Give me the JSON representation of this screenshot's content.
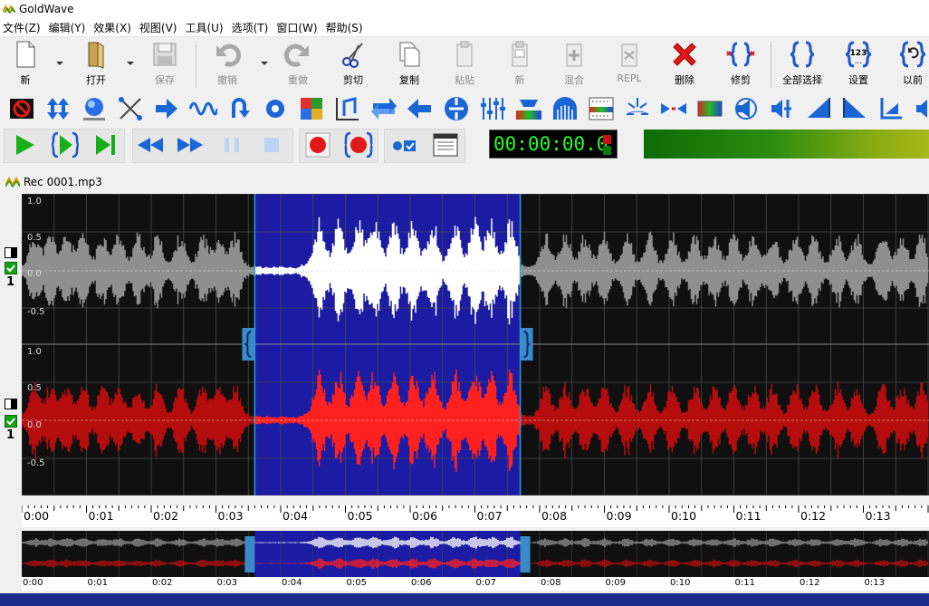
{
  "app": {
    "title": "GoldWave"
  },
  "menu": [
    "文件(Z)",
    "编辑(Y)",
    "效果(X)",
    "视图(V)",
    "工具(U)",
    "选项(T)",
    "窗口(W)",
    "帮助(S)"
  ],
  "toolbar": {
    "new": "新",
    "open": "打开",
    "save": "保存",
    "undo": "撤销",
    "redo": "重做",
    "cut": "剪切",
    "copy": "复制",
    "paste": "粘贴",
    "paste_new": "新",
    "mix": "混合",
    "replace": "REPL",
    "delete": "删除",
    "trim": "修剪",
    "select_all": "全部选择",
    "settings": "设置",
    "previous": "以前"
  },
  "counter": {
    "time": "00:00:00.0"
  },
  "document": {
    "title": "Rec 0001.mp3"
  },
  "channels": [
    {
      "number": "1",
      "y_labels": [
        "1.0",
        "0.5",
        "0.0",
        "-0.5"
      ]
    },
    {
      "number": "1",
      "y_labels": [
        "1.0",
        "0.5",
        "0.0",
        "-0.5"
      ]
    }
  ],
  "timeline": {
    "ticks": [
      "0:00",
      "0:01",
      "0:02",
      "0:03",
      "0:04",
      "0:05",
      "0:06",
      "0:07",
      "0:08",
      "0:09",
      "0:10",
      "0:11",
      "0:12",
      "0:13"
    ]
  },
  "overview_timeline": {
    "ticks": [
      "0:00",
      "0:01",
      "0:02",
      "0:03",
      "0:04",
      "0:05",
      "0:06",
      "0:07",
      "0:08",
      "0:09",
      "0:10",
      "0:11",
      "0:12",
      "0:13"
    ]
  },
  "selection": {
    "start_seconds": 3.6,
    "end_seconds": 7.7
  },
  "colors": {
    "selection": "#1b1ba3",
    "left_channel": "#8f8f8f",
    "left_channel_selected": "#ffffff",
    "right_channel": "#b50d0d",
    "right_channel_selected": "#ff2020",
    "wave_bg": "#101010",
    "counter_text": "#24ff24"
  }
}
